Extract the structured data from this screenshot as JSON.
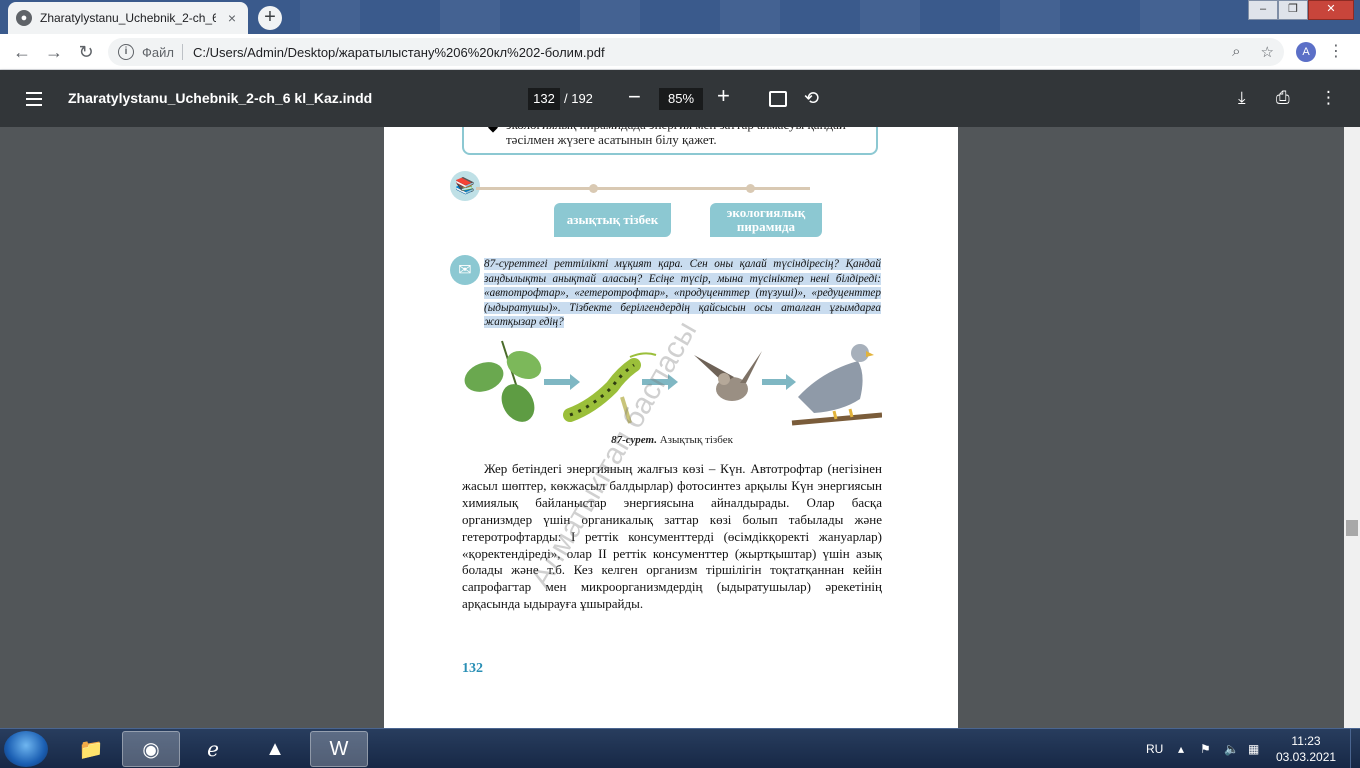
{
  "browser": {
    "tab_title": "Zharatylystanu_Uchebnik_2-ch_6",
    "tab_close": "×",
    "new_tab": "+",
    "url_scheme": "Файл",
    "url": "C:/Users/Admin/Desktop/жаратылыстану%206%20кл%202-болим.pdf",
    "avatar_letter": "A"
  },
  "pdf_toolbar": {
    "doc_name": "Zharatylystanu_Uchebnik_2-ch_6 kl_Kaz.indd",
    "current_page": "132",
    "total_pages": "/ 192",
    "zoom": "85%"
  },
  "page": {
    "goal_text": "экологиялық пирамидада энергия мен заттар алмасуы қандай тәсілмен жүзеге асатынын білу қажет.",
    "key_term_1": "азықтық тізбек",
    "key_term_2": "экологиялық пирамида",
    "question_lead": "87-суреттегі",
    "question_text": " реттілікті мұқият қара. Сен оны қалай түсіндіресің? Қандай заңдылықты анықтай аласың? Есіңе түсір, мына түсініктер нені білдіреді: «автотрофтар», «гетеротрофтар», «продуценттер (түзуші)», «редуценттер (ыдыратушы)». Тізбекте берілгендердің қайсысын осы аталған ұғымдарға жатқызар едің?",
    "figure_caption_num": "87-сурет.",
    "figure_caption_text": " Азықтық тізбек",
    "body_text": "Жер бетіндегі энергияның жалғыз көзі – Күн. Автотрофтар (негізінен жасыл шөптер, көкжасыл балдырлар) фотосинтез арқылы Күн энергиясын химиялық байланыстар энергиясына айналдырады. Олар басқа организмдер үшін органикалық заттар көзі болып табылады және гетеротрофтарды: I реттік консументтерді (өсімдікқоректі жануарлар) «қоректендіреді», олар II реттік консументтер (жыртқыштар) үшін азық болады және т.б. Кез келген организм тіршілігін тоқтатқаннан кейін сапрофагтар мен микроорганизмдердің (ыдыратушылар) әрекетінің арқасында ыдырауға ұшырайды.",
    "page_number": "132",
    "watermark": "Алматыкітап баспасы"
  },
  "taskbar": {
    "lang": "RU",
    "time": "11:23",
    "date": "03.03.2021"
  },
  "colors": {
    "accent_teal": "#8cc8d2",
    "pdf_toolbar": "#323639",
    "page_number": "#2a8fb5"
  }
}
